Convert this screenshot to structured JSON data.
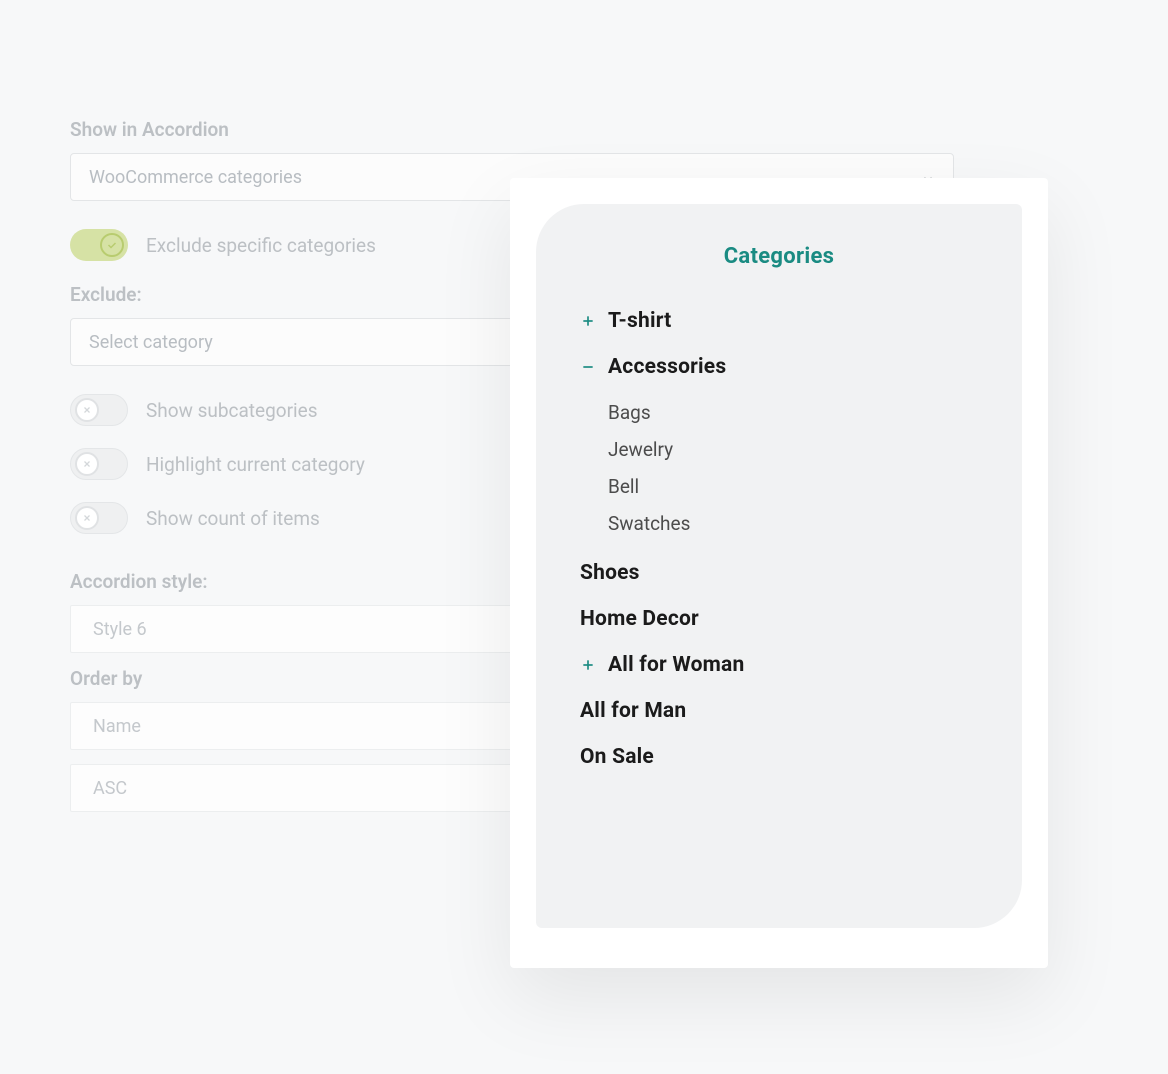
{
  "settings": {
    "show_in_accordion": {
      "label": "Show in Accordion",
      "value": "WooCommerce categories"
    },
    "exclude_toggle": {
      "label": "Exclude specific categories",
      "on": true
    },
    "exclude_field": {
      "label": "Exclude:",
      "placeholder": "Select category"
    },
    "toggles": [
      {
        "label": "Show subcategories",
        "on": false
      },
      {
        "label": "Highlight current category",
        "on": false
      },
      {
        "label": "Show count of items",
        "on": false
      }
    ],
    "accordion_style": {
      "label": "Accordion style:",
      "value": "Style 6"
    },
    "order_by": {
      "label": "Order by",
      "field": "Name",
      "direction": "ASC"
    }
  },
  "preview": {
    "title": "Categories",
    "items": [
      {
        "icon": "plus",
        "name": "T-shirt"
      },
      {
        "icon": "minus",
        "name": "Accessories",
        "children": [
          "Bags",
          "Jewelry",
          "Bell",
          "Swatches"
        ]
      },
      {
        "icon": "",
        "name": "Shoes"
      },
      {
        "icon": "",
        "name": "Home Decor"
      },
      {
        "icon": "plus",
        "name": "All for Woman"
      },
      {
        "icon": "",
        "name": "All for Man"
      },
      {
        "icon": "",
        "name": "On Sale"
      }
    ]
  }
}
